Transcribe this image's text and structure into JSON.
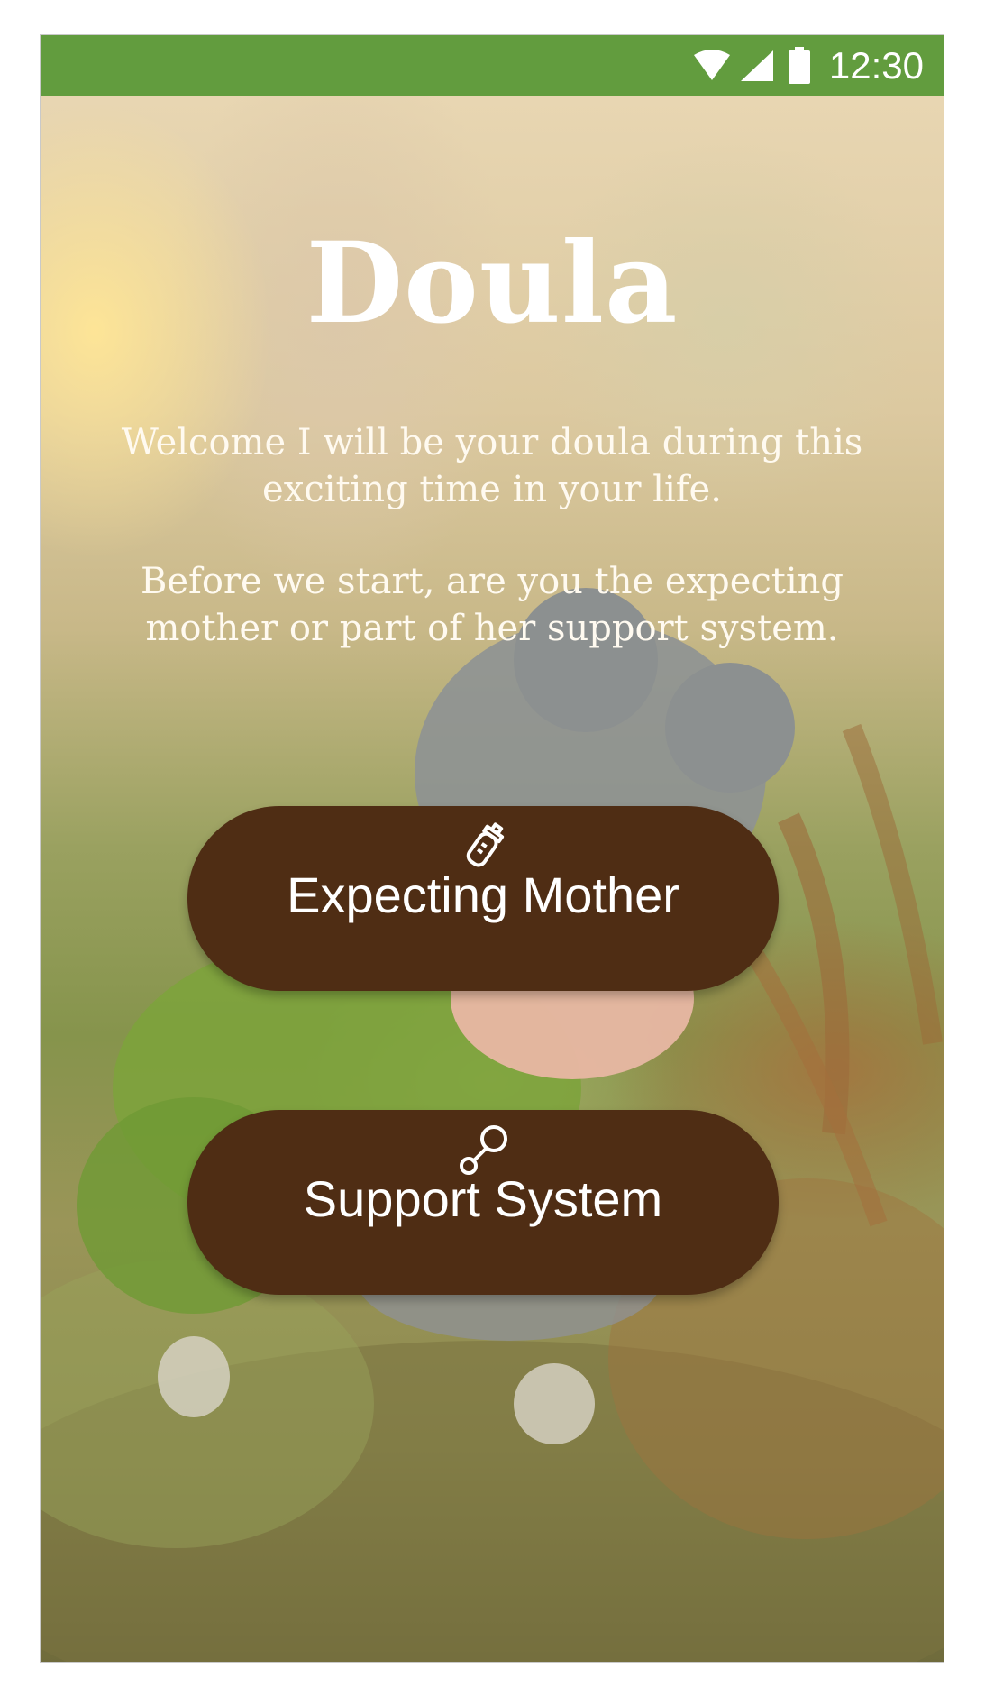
{
  "status_bar": {
    "time": "12:30",
    "icons": [
      "wifi-icon",
      "cellular-signal-icon",
      "battery-icon"
    ],
    "color": "#629c3e"
  },
  "app": {
    "title": "Doula",
    "welcome_text": "Welcome I will be your doula during this exciting time in your life.",
    "question_text": "Before we start, are you the expecting mother or part of her support system."
  },
  "buttons": {
    "expecting_mother": {
      "label": "Expecting Mother",
      "icon": "baby-bottle-icon"
    },
    "support_system": {
      "label": "Support System",
      "icon": "rattle-icon"
    },
    "color": "#4f2d14"
  }
}
